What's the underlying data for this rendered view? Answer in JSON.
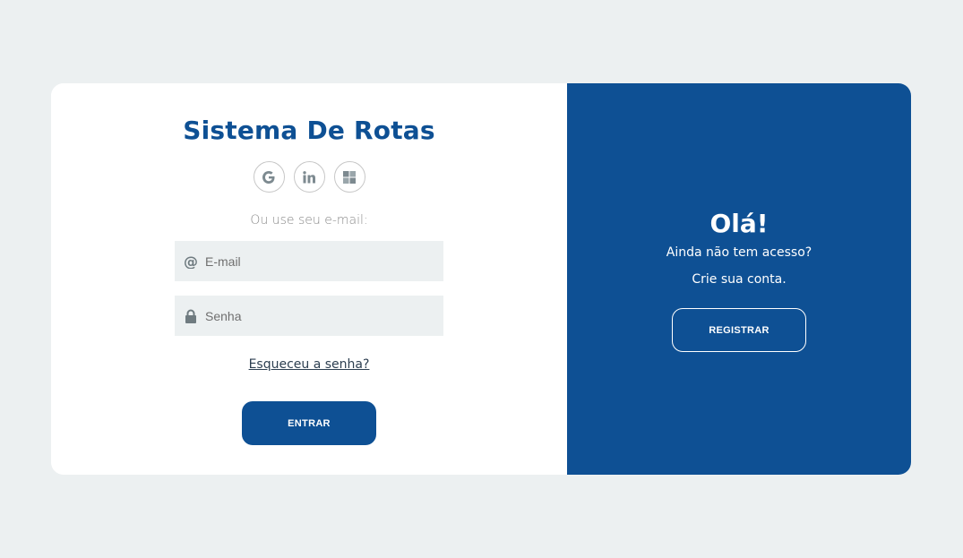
{
  "login": {
    "title": "Sistema De Rotas",
    "socials": [
      {
        "icon": "google-icon"
      },
      {
        "icon": "linkedin-icon"
      },
      {
        "icon": "microsoft-icon"
      }
    ],
    "hint": "Ou use seu e-mail:",
    "email_placeholder": "E-mail",
    "password_placeholder": "Senha",
    "forgot_label": "Esqueceu a senha?",
    "submit_label": "ENTRAR"
  },
  "signup_panel": {
    "heading": "Olá!",
    "line1": "Ainda não tem acesso?",
    "line2": "Crie sua conta.",
    "register_label": "REGISTRAR"
  },
  "colors": {
    "primary": "#0e5094",
    "background": "#ecf0f1",
    "input_bg": "#ecf0f1"
  }
}
